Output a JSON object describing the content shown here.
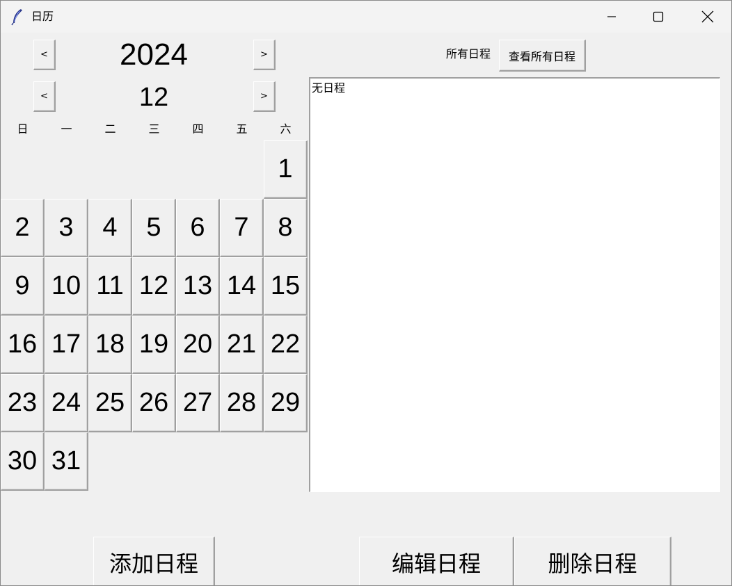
{
  "window": {
    "title": "日历"
  },
  "nav": {
    "prev_label": "<",
    "next_label": ">",
    "year": "2024",
    "month": "12"
  },
  "weekdays": [
    "日",
    "一",
    "二",
    "三",
    "四",
    "五",
    "六"
  ],
  "days": [
    "1",
    "2",
    "3",
    "4",
    "5",
    "6",
    "7",
    "8",
    "9",
    "10",
    "11",
    "12",
    "13",
    "14",
    "15",
    "16",
    "17",
    "18",
    "19",
    "20",
    "21",
    "22",
    "23",
    "24",
    "25",
    "26",
    "27",
    "28",
    "29",
    "30",
    "31"
  ],
  "schedule_panel": {
    "all_label": "所有日程",
    "view_all_button": "查看所有日程",
    "empty_text": "无日程"
  },
  "actions": {
    "add": "添加日程",
    "edit": "编辑日程",
    "delete": "删除日程"
  },
  "icons": {
    "app": "feather-icon",
    "minimize": "minimize-icon",
    "maximize": "maximize-icon",
    "close": "close-icon"
  }
}
